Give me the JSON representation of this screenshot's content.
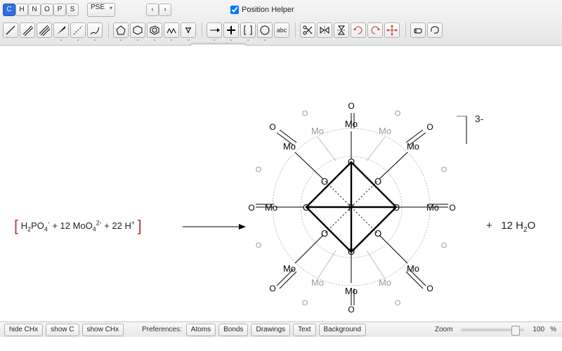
{
  "top_row": {
    "atoms": [
      "C",
      "H",
      "N",
      "O",
      "P",
      "S"
    ],
    "active_atom": "C",
    "pse_label": "PSE",
    "position_helper_label": "Position Helper",
    "position_helper_checked": true
  },
  "tool_row": {
    "bond_tools": [
      "bond-single",
      "bond-double",
      "bond-triple",
      "bond-wedge",
      "bond-dash",
      "bond-wavy"
    ],
    "ring_tools": [
      "ring-5",
      "ring-6",
      "ring-6a",
      "ring-bonds",
      "ring-misc"
    ],
    "arrow_tools": [
      "arrow",
      "plus",
      "bracket",
      "circle",
      "text-abc"
    ],
    "draw_tools": [
      "scissors",
      "mirror-h",
      "mirror-v",
      "rotate-a",
      "rotate-b",
      "move"
    ],
    "misc_tools": [
      "eraser",
      "lasso"
    ]
  },
  "popover": {
    "options": [
      "( )",
      "⌐"
    ],
    "selected": 0
  },
  "reaction": {
    "lhs_html": "H<sub>2</sub>PO<sub>4</sub><sup>-</sup> + 12 MoO<sub>4</sub><sup>2-</sup> + 22 H<sup>+</sup>",
    "arrow": "→",
    "charge": "3-",
    "rhs_plus_html": "+&nbsp;&nbsp;&nbsp;12 H<sub>2</sub>O"
  },
  "statusbar": {
    "hide_chx": "hide CHx",
    "show_c": "show C",
    "show_chx": "show CHx",
    "preferences_label": "Preferences:",
    "pref_buttons": [
      "Atoms",
      "Bonds",
      "Drawings",
      "Text",
      "Background"
    ],
    "zoom_label": "Zoom",
    "zoom_value": "100",
    "zoom_pct": "%"
  }
}
